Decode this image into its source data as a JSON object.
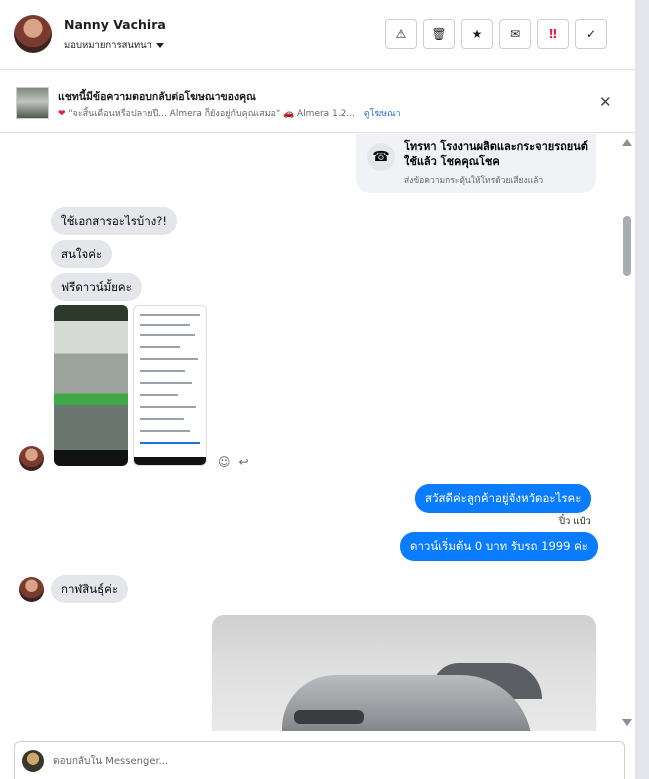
{
  "header": {
    "user_name": "Nanny Vachira",
    "assign_label": "มอบหมายการสนทนา",
    "actions": [
      {
        "name": "report-icon",
        "glyph": "⚠"
      },
      {
        "name": "trash-icon",
        "glyph": "🗑"
      },
      {
        "name": "star-icon",
        "glyph": "★"
      },
      {
        "name": "mark-unread-icon",
        "glyph": "✉"
      },
      {
        "name": "spam-icon",
        "glyph": "‼"
      },
      {
        "name": "done-icon",
        "glyph": "✓"
      }
    ]
  },
  "ad_banner": {
    "title": "แชทนี้มีข้อความตอบกลับต่อโฆษณาของคุณ",
    "subtitle": "\"จะสิ้นเดือนหรือปลายปี... Almera ก็ยังอยู่กับคุณเสมอ\" 🚗 Almera 1.2...",
    "link": "ดูโฆษณา"
  },
  "call_card": {
    "title": "โทรหา โรงงานผลิตและกระจายรถยนต์ใช้แล้ว โชคคุณโชค",
    "subtitle": "ส่งข้อความกระตุ้นให้โทรด้วยเสียงแล้ว"
  },
  "messages": {
    "in1": "ใช้เอกสารอะไรบ้าง?!",
    "in2": "สนใจค่ะ",
    "in3": "ฟรีดาวน์มั้ยคะ",
    "out1": "สวัสดีค่ะลูกค้าอยู่จังหวัดอะไรคะ",
    "seen": "ปิ๋ว แป๋ว",
    "out2": "ดาวน์เริ่มต้น 0 บาท รับรถ 1999 ค่ะ",
    "in4": "กาฬสินธุ์ค่ะ"
  },
  "composer": {
    "placeholder": "ตอบกลับใน Messenger..."
  },
  "colors": {
    "outgoing_bubble": "#0a7cff",
    "incoming_bubble": "#e4e6eb",
    "link": "#216fdb"
  }
}
